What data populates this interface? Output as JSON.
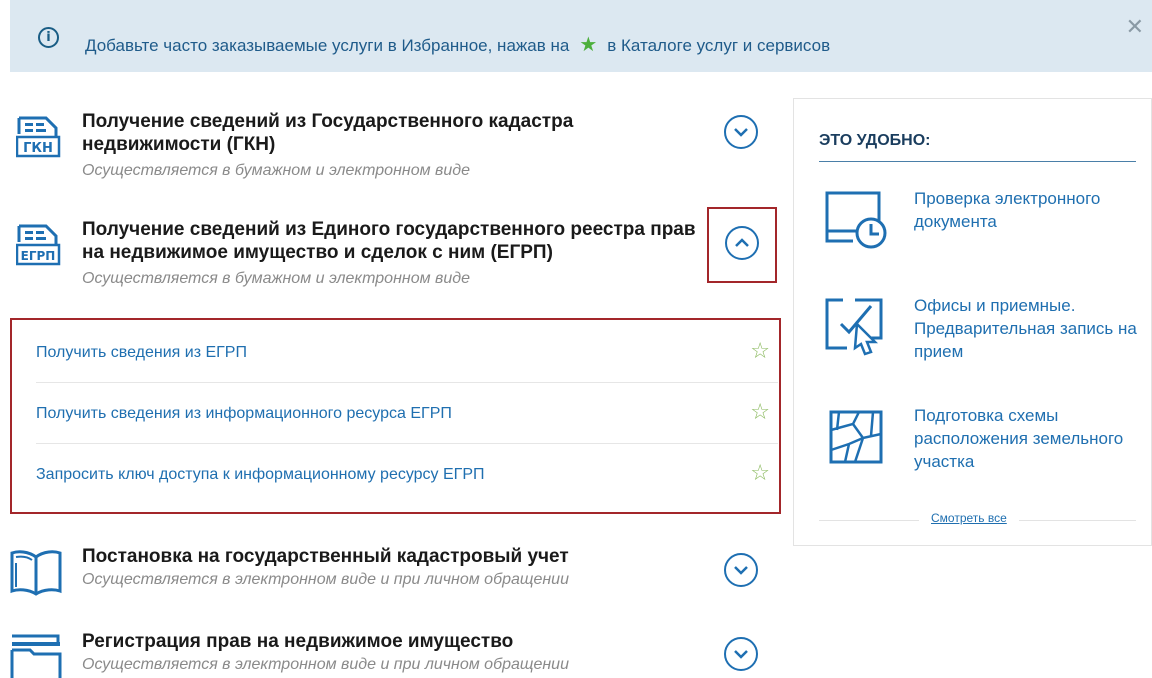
{
  "banner": {
    "info_icon": "info-circle-icon",
    "text_before": "Добавьте часто заказываемые услуги в Избранное, нажав на",
    "star_icon": "★",
    "text_after": "в Каталоге услуг и сервисов",
    "close_icon": "✕"
  },
  "services": [
    {
      "badge": "ГКН",
      "title": "Получение сведений из Государственного кадастра недвижимости (ГКН)",
      "subtitle": "Осуществляется в бумажном и электронном виде",
      "toggle": "expand"
    },
    {
      "badge": "ЕГРП",
      "title": "Получение сведений из Единого государственного реестра прав на недвижимое имущество и сделок с ним (ЕГРП)",
      "subtitle": "Осуществляется в бумажном и электронном виде",
      "toggle": "collapse"
    },
    {
      "title": "Постановка на государственный кадастровый учет",
      "subtitle": "Осуществляется в электронном виде и при личном обращении",
      "toggle": "expand"
    },
    {
      "title": "Регистрация прав на недвижимое имущество",
      "subtitle": "Осуществляется в электронном виде и при личном обращении",
      "toggle": "expand"
    }
  ],
  "sub_services": [
    {
      "label": "Получить сведения из ЕГРП",
      "fav": "☆"
    },
    {
      "label": "Получить сведения из информационного ресурса ЕГРП",
      "fav": "☆"
    },
    {
      "label": "Запросить ключ доступа к информационному ресурсу ЕГРП",
      "fav": "☆"
    }
  ],
  "sidebar": {
    "header": "ЭТО УДОБНО:",
    "tips": [
      {
        "label": "Проверка электронного документа",
        "icon": "document-clock-icon"
      },
      {
        "label": "Офисы и приемные. Предварительная запись на прием",
        "icon": "cursor-screen-icon"
      },
      {
        "label": "Подготовка схемы расположения земельного участка",
        "icon": "land-map-icon"
      }
    ],
    "see_all": "Смотреть все"
  },
  "colors": {
    "accent": "#1e6fb2",
    "highlight": "#a3262a",
    "banner_bg": "#dce8f1",
    "star": "#4caf3c"
  }
}
